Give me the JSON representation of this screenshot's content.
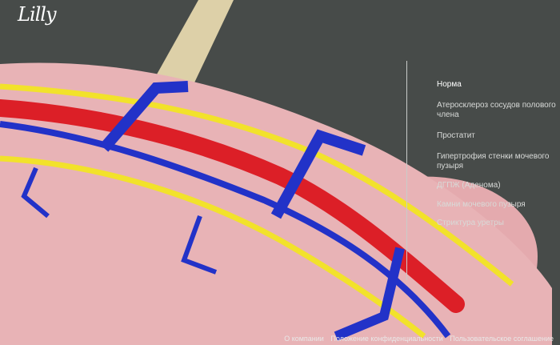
{
  "brand": {
    "logo_text": "Lilly",
    "logo_icon": "lilly-script-logo"
  },
  "menu": {
    "items": [
      {
        "label": "Норма",
        "active": true
      },
      {
        "label": "Атеросклероз сосудов полового члена",
        "active": false
      },
      {
        "label": "Простатит",
        "active": false
      },
      {
        "label": "Гипертрофия стенки мочевого пузыря",
        "active": false
      },
      {
        "label": "ДГПЖ (Аденома)",
        "active": false
      },
      {
        "label": "Камни мочевого пузыря",
        "active": false
      },
      {
        "label": "Стриктура уретры",
        "active": false
      }
    ]
  },
  "footer": {
    "about": "О компании",
    "privacy": "Положение конфиденциальности",
    "terms": "Пользовательское соглашение"
  },
  "colors": {
    "background": "#474b49",
    "tissue": "#e8b1b4",
    "artery": "#e0222a",
    "vein": "#2232c8",
    "nerve": "#f3e42a",
    "bone": "#ddd0a8"
  }
}
